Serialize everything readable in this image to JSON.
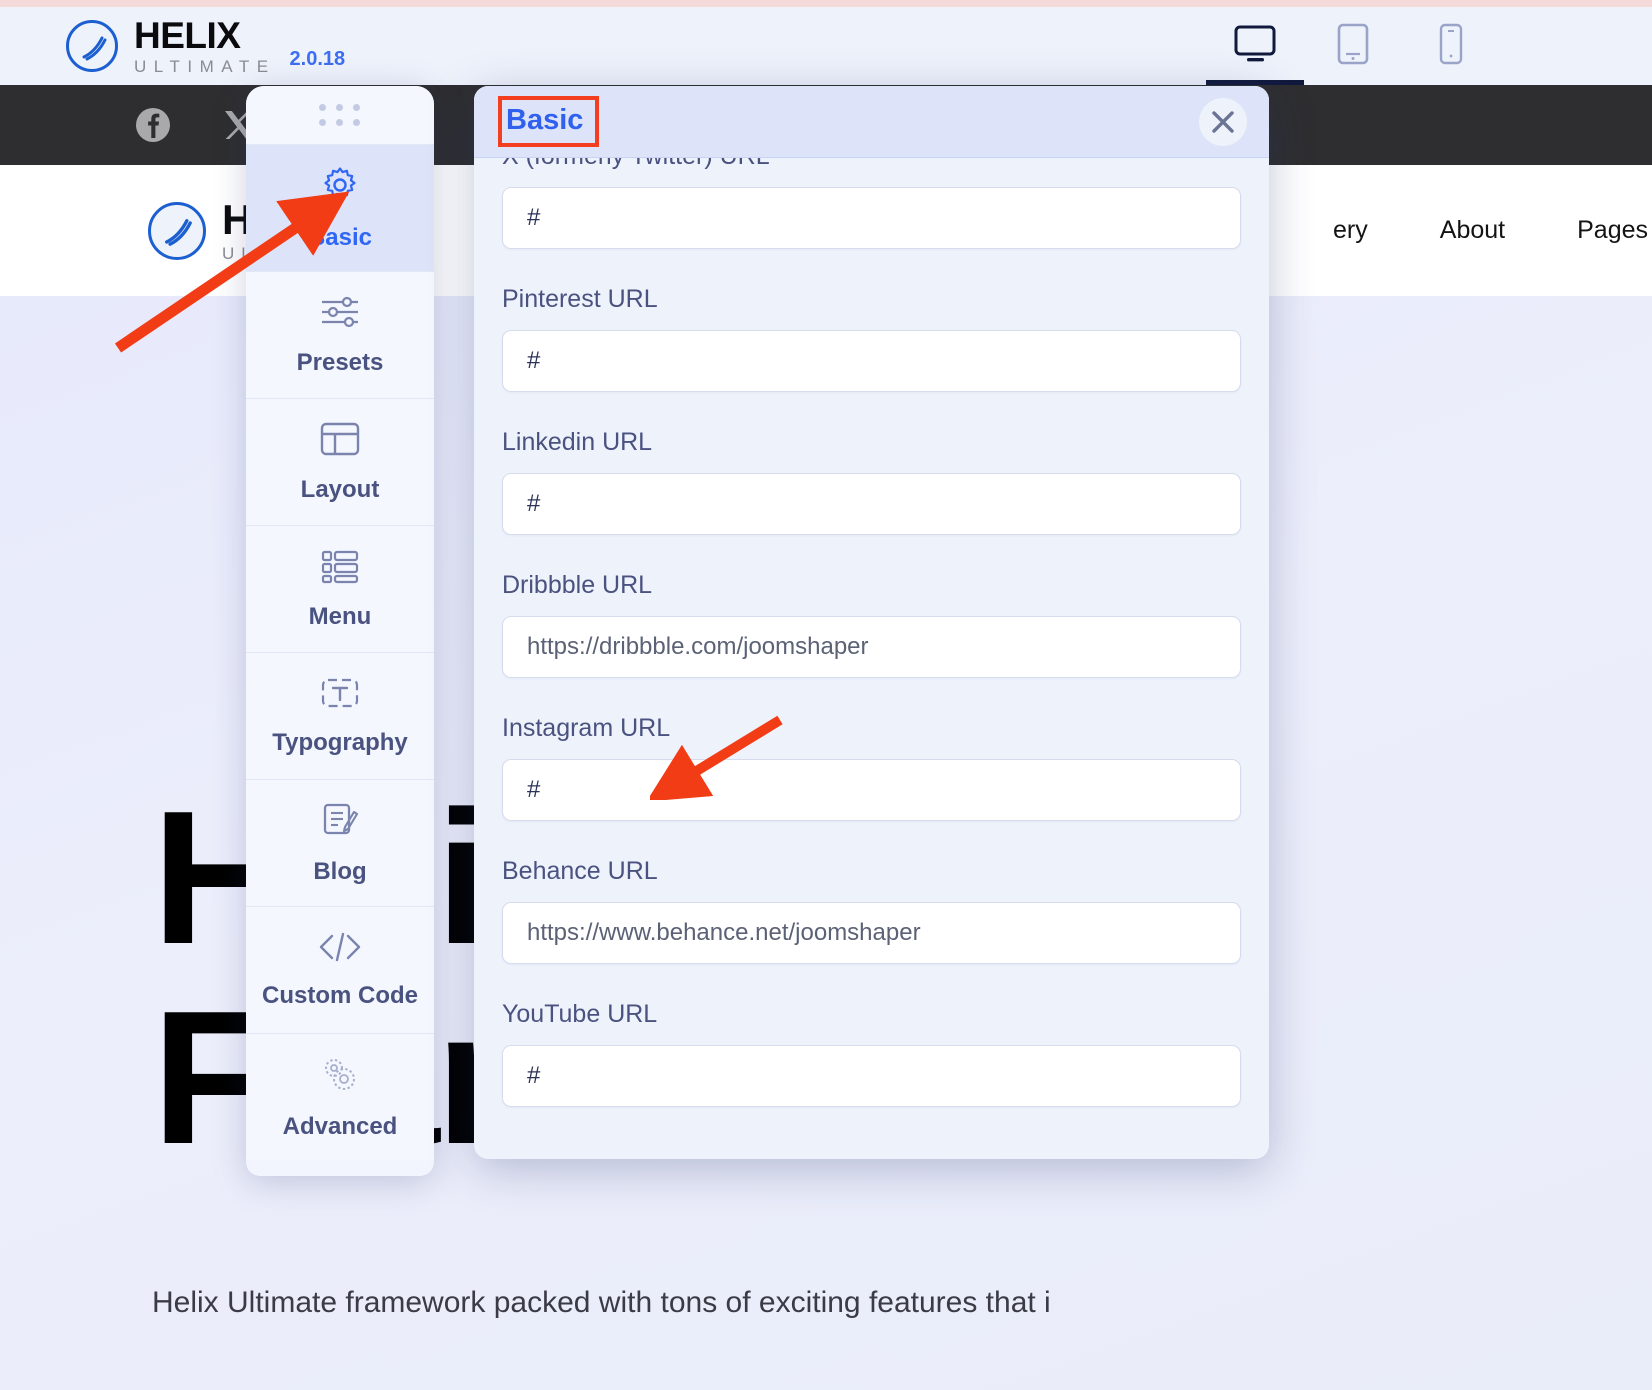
{
  "admin_bar": {
    "brand_title": "HELIX",
    "brand_subtitle": "ULTIMATE",
    "version": "2.0.18",
    "devices": [
      {
        "name": "desktop-view",
        "label": "Desktop",
        "active": true
      },
      {
        "name": "tablet-view",
        "label": "Tablet",
        "active": false
      },
      {
        "name": "mobile-view",
        "label": "Mobile",
        "active": false
      }
    ]
  },
  "social_strip": {
    "icons": [
      "facebook-icon",
      "x-twitter-icon",
      "instagram-icon"
    ]
  },
  "site_header": {
    "logo_title": "HELIX",
    "logo_subtitle": "ULTIMATE",
    "nav": [
      "ery",
      "About",
      "Pages"
    ]
  },
  "hero": {
    "line1": "Helix",
    "line2": "Framework",
    "paragraph": "Helix Ultimate framework packed with tons of exciting features that i"
  },
  "sidebar": {
    "drag_handle": "drag-handle",
    "items": [
      {
        "label": "Basic",
        "icon": "gear-icon",
        "active": true
      },
      {
        "label": "Presets",
        "icon": "sliders-icon",
        "active": false
      },
      {
        "label": "Layout",
        "icon": "layout-icon",
        "active": false
      },
      {
        "label": "Menu",
        "icon": "menu-list-icon",
        "active": false
      },
      {
        "label": "Typography",
        "icon": "typography-icon",
        "active": false
      },
      {
        "label": "Blog",
        "icon": "blog-edit-icon",
        "active": false
      },
      {
        "label": "Custom Code",
        "icon": "code-icon",
        "active": false
      },
      {
        "label": "Advanced",
        "icon": "advanced-gears-icon",
        "active": false
      }
    ]
  },
  "modal": {
    "title": "Basic",
    "close_icon": "close-icon",
    "fields": [
      {
        "label": "X (formerly Twitter) URL",
        "value": "#",
        "is_placeholder": false
      },
      {
        "label": "Pinterest URL",
        "value": "#",
        "is_placeholder": false
      },
      {
        "label": "Linkedin URL",
        "value": "#",
        "is_placeholder": false
      },
      {
        "label": "Dribbble URL",
        "value": "https://dribbble.com/joomshaper",
        "is_placeholder": true
      },
      {
        "label": "Instagram URL",
        "value": "#",
        "is_placeholder": false
      },
      {
        "label": "Behance URL",
        "value": "https://www.behance.net/joomshaper",
        "is_placeholder": true
      },
      {
        "label": "YouTube URL",
        "value": "#",
        "is_placeholder": false
      }
    ]
  },
  "annotations": {
    "arrow_to_basic_tab": "red-arrow-pointing-to-basic-sidebar-item",
    "arrow_to_instagram": "red-arrow-pointing-to-instagram-url-field",
    "highlight_basic_title": "red-rectangle-around-basic-modal-title"
  },
  "colors": {
    "accent_blue": "#3060ee",
    "annotation_red": "#f43e20",
    "panel_bg": "#eef2fb",
    "header_bg": "#dde3f8",
    "dark_bar": "#2e2e30"
  }
}
